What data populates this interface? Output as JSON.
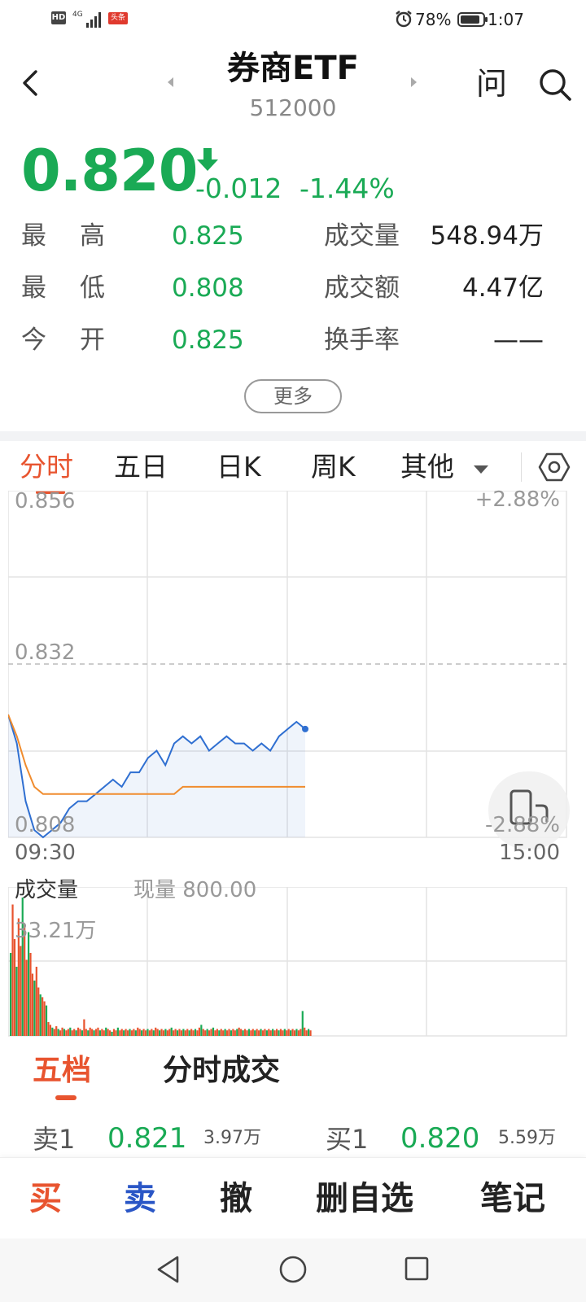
{
  "status_bar": {
    "hd_badge": "HD",
    "network": "4G",
    "app_badge": "头条",
    "battery_pct": "78%",
    "time": "1:07",
    "icons": [
      "alarm-icon",
      "battery-icon",
      "signal-icon"
    ]
  },
  "header": {
    "title": "券商ETF",
    "code": "512000",
    "ask_label": "问"
  },
  "quote": {
    "price": "0.820",
    "change": "-0.012",
    "change_pct": "-1.44%",
    "color_down": "#1aaa55",
    "stats": {
      "high_label_1": "最",
      "high_label_2": "高",
      "high": "0.825",
      "low_label_1": "最",
      "low_label_2": "低",
      "low": "0.808",
      "open_label_1": "今",
      "open_label_2": "开",
      "open": "0.825",
      "volume_label": "成交量",
      "volume": "548.94万",
      "amount_label": "成交额",
      "amount": "4.47亿",
      "turnover_label": "换手率",
      "turnover": "——"
    },
    "more_label": "更多"
  },
  "tabs": {
    "items": [
      "分时",
      "五日",
      "日K",
      "周K",
      "其他"
    ],
    "active": "分时",
    "accent": "#e8542f"
  },
  "chart": {
    "y_top": "0.856",
    "y_mid": "0.832",
    "y_bottom": "0.808",
    "pct_top": "+2.88%",
    "pct_bottom": "-2.88%",
    "x_start": "09:30",
    "x_end": "15:00",
    "price_color": "#2f6fd1",
    "avg_color": "#f08c2e"
  },
  "chart_data": {
    "type": "line",
    "title": "",
    "xlabel": "",
    "ylabel": "",
    "ylim": [
      0.808,
      0.856
    ],
    "x_range": [
      "09:30",
      "15:00"
    ],
    "grid": true,
    "series": [
      {
        "values": [
          0.825,
          0.821,
          0.813,
          0.809,
          0.808,
          0.809,
          0.81,
          0.812,
          0.813,
          0.813,
          0.814,
          0.815,
          0.816,
          0.815,
          0.817,
          0.817,
          0.819,
          0.82,
          0.818,
          0.821,
          0.822,
          0.821,
          0.822,
          0.82,
          0.821,
          0.822,
          0.821,
          0.821,
          0.82,
          0.821,
          0.82,
          0.822,
          0.823,
          0.824,
          0.823
        ],
        "color": "#2f6fd1"
      },
      {
        "values": [
          0.825,
          0.822,
          0.818,
          0.815,
          0.814,
          0.814,
          0.814,
          0.814,
          0.814,
          0.814,
          0.814,
          0.814,
          0.814,
          0.814,
          0.814,
          0.814,
          0.814,
          0.814,
          0.814,
          0.814,
          0.815,
          0.815,
          0.815,
          0.815,
          0.815,
          0.815,
          0.815,
          0.815,
          0.815,
          0.815,
          0.815,
          0.815,
          0.815,
          0.815,
          0.815
        ],
        "color": "#f08c2e"
      }
    ]
  },
  "volume": {
    "label": "成交量",
    "current_label": "现量 800.00",
    "max_label": "33.21万",
    "up_color": "#e8542f",
    "down_color": "#1aaa55",
    "bars": [
      0.6,
      0.95,
      0.7,
      0.5,
      0.85,
      0.65,
      1.0,
      0.8,
      0.55,
      0.75,
      0.6,
      0.45,
      0.4,
      0.5,
      0.35,
      0.3,
      0.28,
      0.25,
      0.22,
      0.1,
      0.08,
      0.06,
      0.05,
      0.07,
      0.05,
      0.04,
      0.06,
      0.05,
      0.04,
      0.05,
      0.06,
      0.04,
      0.05,
      0.04,
      0.06,
      0.05,
      0.04,
      0.12,
      0.05,
      0.04,
      0.06,
      0.05,
      0.04,
      0.05,
      0.06,
      0.04,
      0.05,
      0.04,
      0.06,
      0.05,
      0.04,
      0.03,
      0.05,
      0.04,
      0.06,
      0.04,
      0.05,
      0.04,
      0.05,
      0.04,
      0.05,
      0.04,
      0.05,
      0.04,
      0.06,
      0.05,
      0.04,
      0.05,
      0.04,
      0.05,
      0.04,
      0.05,
      0.04,
      0.06,
      0.05,
      0.04,
      0.05,
      0.04,
      0.05,
      0.04,
      0.05,
      0.06,
      0.04,
      0.05,
      0.04,
      0.05,
      0.04,
      0.05,
      0.04,
      0.05,
      0.04,
      0.05,
      0.04,
      0.05,
      0.04,
      0.06,
      0.08,
      0.05,
      0.04,
      0.05,
      0.04,
      0.05,
      0.06,
      0.04,
      0.05,
      0.04,
      0.05,
      0.04,
      0.05,
      0.04,
      0.05,
      0.04,
      0.05,
      0.04,
      0.05,
      0.06,
      0.05,
      0.04,
      0.05,
      0.04,
      0.05,
      0.04,
      0.05,
      0.04,
      0.05,
      0.04,
      0.05,
      0.04,
      0.05,
      0.04,
      0.05,
      0.04,
      0.05,
      0.04,
      0.05,
      0.04,
      0.05,
      0.04,
      0.05,
      0.04,
      0.05,
      0.04,
      0.05,
      0.04,
      0.05,
      0.04,
      0.05,
      0.18,
      0.06,
      0.04,
      0.05,
      0.04
    ]
  },
  "order_book": {
    "tabs": [
      "五档",
      "分时成交"
    ],
    "active": "五档",
    "sell_label": "卖1",
    "sell_price": "0.821",
    "sell_vol": "3.97万",
    "buy_label": "买1",
    "buy_price": "0.820",
    "buy_vol": "5.59万"
  },
  "actions": {
    "buy": "买",
    "sell": "卖",
    "cancel": "撤",
    "remove_fav": "删自选",
    "notes": "笔记",
    "buy_color": "#e8542f",
    "sell_color": "#2a56c6"
  },
  "navbar": {
    "icons": [
      "nav-back-icon",
      "nav-home-icon",
      "nav-recent-icon"
    ]
  }
}
